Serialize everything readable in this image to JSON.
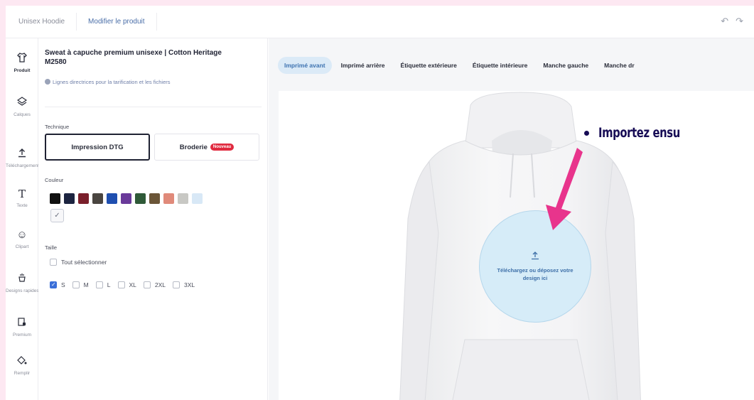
{
  "breadcrumb": {
    "product": "Unisex Hoodie",
    "current": "Modifier le produit"
  },
  "toolbar": {
    "undo_icon": "undo-icon",
    "redo_icon": "redo-icon"
  },
  "rail": [
    {
      "label": "Produit",
      "icon": "shirt-icon"
    },
    {
      "label": "Calques",
      "icon": "layers-icon"
    },
    {
      "label": "Téléchargements",
      "icon": "upload-icon"
    },
    {
      "label": "Texte",
      "icon": "text-icon"
    },
    {
      "label": "Clipart",
      "icon": "smiley-icon"
    },
    {
      "label": "Designs rapides",
      "icon": "quick-designs-icon"
    },
    {
      "label": "Premium",
      "icon": "premium-icon"
    },
    {
      "label": "Remplir",
      "icon": "fill-icon"
    }
  ],
  "product": {
    "title": "Sweat à capuche premium unisexe | Cotton Heritage M2580",
    "guidelines_link": "Lignes directrices pour la tarification et les fichiers"
  },
  "technique": {
    "label": "Technique",
    "options": [
      {
        "label": "Impression DTG",
        "selected": true
      },
      {
        "label": "Broderie",
        "badge": "Nouveau",
        "selected": false
      }
    ]
  },
  "color": {
    "label": "Couleur",
    "swatches": [
      "#101010",
      "#1c2440",
      "#7a1f2b",
      "#4a4540",
      "#1f4fb0",
      "#6a3a9a",
      "#2f5a38",
      "#6b5638",
      "#e08a7a",
      "#c8c8c4",
      "#d8e8f6"
    ]
  },
  "size": {
    "label": "Taille",
    "select_all": "Tout sélectionner",
    "options": [
      {
        "label": "S",
        "checked": true
      },
      {
        "label": "M",
        "checked": false
      },
      {
        "label": "L",
        "checked": false
      },
      {
        "label": "XL",
        "checked": false
      },
      {
        "label": "2XL",
        "checked": false
      },
      {
        "label": "3XL",
        "checked": false
      }
    ]
  },
  "placement_tabs": [
    "Imprimé avant",
    "Imprimé arrière",
    "Étiquette extérieure",
    "Étiquette intérieure",
    "Manche gauche",
    "Manche dr"
  ],
  "upload": {
    "text": "Téléchargez ou déposez votre design ici"
  },
  "overlay": {
    "instruction": "Importez ensu",
    "arrow_color": "#e8348c",
    "text_color": "#170c55"
  }
}
